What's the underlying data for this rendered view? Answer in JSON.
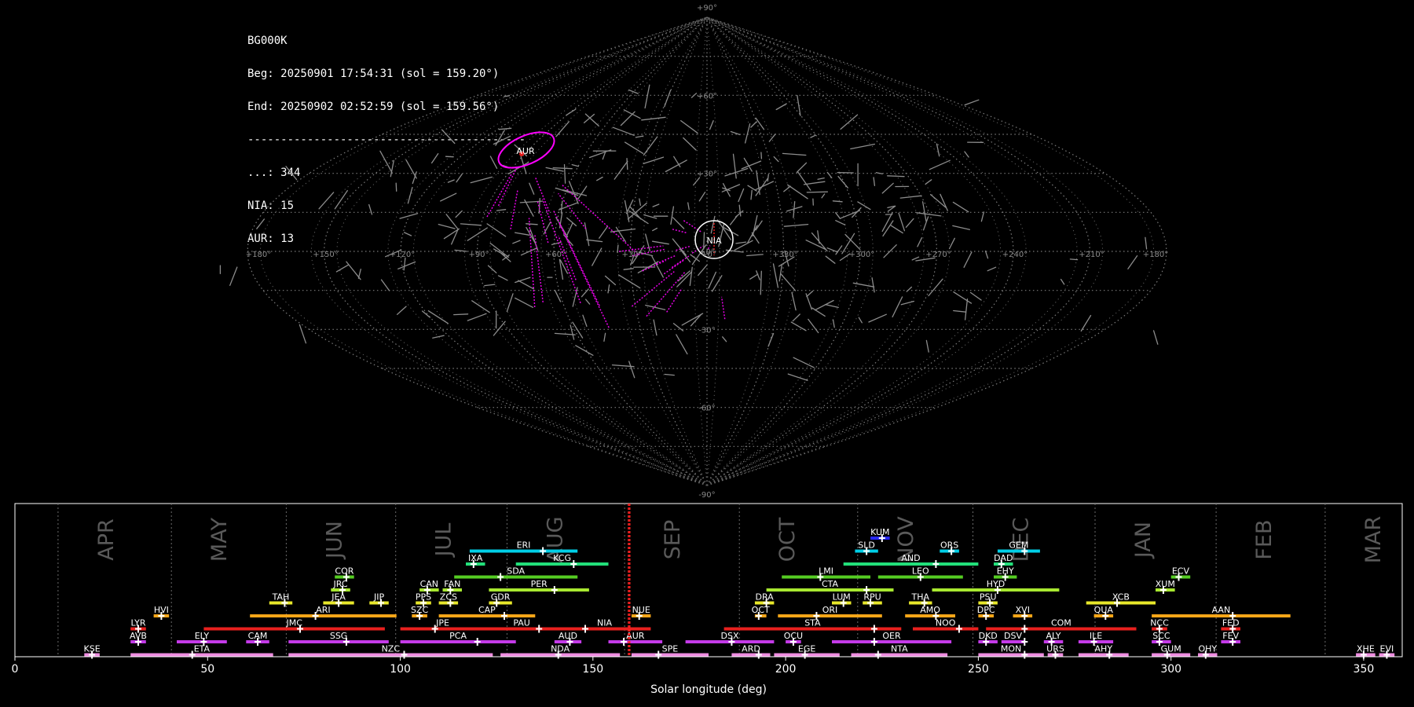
{
  "info": {
    "station": "BG000K",
    "begin": "Beg: 20250901 17:54:31 (sol = 159.20°)",
    "end": "End: 20250902 02:52:59 (sol = 159.56°)",
    "separator": "------------------------------------------",
    "counts": [
      "...: 344",
      "NIA: 15",
      "AUR: 13"
    ]
  },
  "sky_map": {
    "projection": "sinusoidal",
    "lon_labels": [
      "+180°",
      "+150°",
      "+120°",
      "+90°",
      "+60°",
      "+30°",
      "+0°",
      "+330°",
      "+300°",
      "+270°",
      "+240°",
      "+210°",
      "+180°"
    ],
    "lat_labels": [
      "+90°",
      "+60°",
      "+30°",
      "+0°",
      "-30°",
      "-60°",
      "-90°"
    ],
    "radiants": [
      {
        "name": "AUR",
        "color": "#ff00ff"
      },
      {
        "name": "NIA",
        "color": "#ff00ff"
      }
    ],
    "sporadic_color": "#8c8c8c"
  },
  "chart_data": {
    "type": "timeline",
    "xlabel": "Solar longitude (deg)",
    "xlim": [
      0,
      360
    ],
    "x_ticks": [
      0,
      50,
      100,
      150,
      200,
      250,
      300,
      350
    ],
    "current_sol": [
      159.2,
      159.56
    ],
    "months": [
      {
        "name": "APR",
        "sol": 11.2
      },
      {
        "name": "MAY",
        "sol": 40.6
      },
      {
        "name": "JUN",
        "sol": 70.4
      },
      {
        "name": "JUL",
        "sol": 98.8
      },
      {
        "name": "AUG",
        "sol": 127.7
      },
      {
        "name": "SEP",
        "sol": 158.2
      },
      {
        "name": "OCT",
        "sol": 188.0
      },
      {
        "name": "NOV",
        "sol": 218.7
      },
      {
        "name": "DEC",
        "sol": 248.6
      },
      {
        "name": "JAN",
        "sol": 280.3
      },
      {
        "name": "FEB",
        "sol": 311.7
      },
      {
        "name": "MAR",
        "sol": 340.0
      }
    ],
    "showers": [
      {
        "code": "KUM",
        "start": 222,
        "end": 227,
        "peak": 225,
        "row": 9,
        "color": "#2828ff"
      },
      {
        "code": "ERI",
        "start": 118,
        "end": 146,
        "peak": 137,
        "row": 8,
        "color": "#00cfe8"
      },
      {
        "code": "SLD",
        "start": 218,
        "end": 224,
        "peak": 221,
        "row": 8,
        "color": "#00cfe8"
      },
      {
        "code": "ORS",
        "start": 240,
        "end": 245,
        "peak": 243,
        "row": 8,
        "color": "#00cfe8"
      },
      {
        "code": "GEM",
        "start": 255,
        "end": 266,
        "peak": 262,
        "row": 8,
        "color": "#00cfe8"
      },
      {
        "code": "IXA",
        "start": 117,
        "end": 122,
        "peak": 119,
        "row": 7,
        "color": "#22e07a"
      },
      {
        "code": "KCG",
        "start": 130,
        "end": 154,
        "peak": 145,
        "row": 7,
        "color": "#22e07a"
      },
      {
        "code": "AND",
        "start": 215,
        "end": 250,
        "peak": 239,
        "row": 7,
        "color": "#22e07a"
      },
      {
        "code": "DAD",
        "start": 254,
        "end": 259,
        "peak": 256,
        "row": 7,
        "color": "#22e07a"
      },
      {
        "code": "COR",
        "start": 83,
        "end": 88,
        "peak": 86,
        "row": 6,
        "color": "#55cc22"
      },
      {
        "code": "SDA",
        "start": 114,
        "end": 146,
        "peak": 126,
        "row": 6,
        "color": "#55cc22"
      },
      {
        "code": "LMI",
        "start": 199,
        "end": 222,
        "peak": 209,
        "row": 6,
        "color": "#55cc22"
      },
      {
        "code": "LEO",
        "start": 224,
        "end": 246,
        "peak": 235,
        "row": 6,
        "color": "#55cc22"
      },
      {
        "code": "EHY",
        "start": 254,
        "end": 260,
        "peak": 257,
        "row": 6,
        "color": "#55cc22"
      },
      {
        "code": "ECV",
        "start": 300,
        "end": 305,
        "peak": 302,
        "row": 6,
        "color": "#55cc22"
      },
      {
        "code": "JRC",
        "start": 82,
        "end": 87,
        "peak": 85,
        "row": 5,
        "color": "#a8e830"
      },
      {
        "code": "CAN",
        "start": 105,
        "end": 110,
        "peak": 107,
        "row": 5,
        "color": "#a8e830"
      },
      {
        "code": "FAN",
        "start": 111,
        "end": 116,
        "peak": 113,
        "row": 5,
        "color": "#a8e830"
      },
      {
        "code": "PER",
        "start": 123,
        "end": 149,
        "peak": 140,
        "row": 5,
        "color": "#a8e830"
      },
      {
        "code": "CTA",
        "start": 195,
        "end": 228,
        "peak": 221,
        "row": 5,
        "color": "#a8e830"
      },
      {
        "code": "HYD",
        "start": 238,
        "end": 271,
        "peak": 255,
        "row": 5,
        "color": "#a8e830"
      },
      {
        "code": "XUM",
        "start": 296,
        "end": 301,
        "peak": 298,
        "row": 5,
        "color": "#a8e830"
      },
      {
        "code": "TAH",
        "start": 66,
        "end": 72,
        "peak": 70,
        "row": 4,
        "color": "#e8e82a"
      },
      {
        "code": "JEA",
        "start": 80,
        "end": 88,
        "peak": 84,
        "row": 4,
        "color": "#e8e82a"
      },
      {
        "code": "JIP",
        "start": 92,
        "end": 97,
        "peak": 95,
        "row": 4,
        "color": "#e8e82a"
      },
      {
        "code": "PPS",
        "start": 104,
        "end": 108,
        "peak": 106,
        "row": 4,
        "color": "#e8e82a"
      },
      {
        "code": "ZCS",
        "start": 110,
        "end": 115,
        "peak": 113,
        "row": 4,
        "color": "#e8e82a"
      },
      {
        "code": "GDR",
        "start": 123,
        "end": 129,
        "peak": 125,
        "row": 4,
        "color": "#e8e82a"
      },
      {
        "code": "DRA",
        "start": 192,
        "end": 197,
        "peak": 195,
        "row": 4,
        "color": "#e8e82a"
      },
      {
        "code": "LUM",
        "start": 212,
        "end": 217,
        "peak": 215,
        "row": 4,
        "color": "#e8e82a"
      },
      {
        "code": "RPU",
        "start": 220,
        "end": 225,
        "peak": 222,
        "row": 4,
        "color": "#e8e82a"
      },
      {
        "code": "THA",
        "start": 232,
        "end": 238,
        "peak": 236,
        "row": 4,
        "color": "#e8e82a"
      },
      {
        "code": "PSU",
        "start": 250,
        "end": 255,
        "peak": 253,
        "row": 4,
        "color": "#e8e82a"
      },
      {
        "code": "XCB",
        "start": 278,
        "end": 296,
        "peak": 286,
        "row": 4,
        "color": "#e8e82a"
      },
      {
        "code": "HVI",
        "start": 36,
        "end": 40,
        "peak": 38,
        "row": 3,
        "color": "#f5a518"
      },
      {
        "code": "ARI",
        "start": 61,
        "end": 99,
        "peak": 78,
        "row": 3,
        "color": "#f5a518"
      },
      {
        "code": "SZC",
        "start": 103,
        "end": 107,
        "peak": 105,
        "row": 3,
        "color": "#f5a518"
      },
      {
        "code": "CAP",
        "start": 110,
        "end": 135,
        "peak": 127,
        "row": 3,
        "color": "#f5a518"
      },
      {
        "code": "NUE",
        "start": 160,
        "end": 165,
        "peak": 162,
        "row": 3,
        "color": "#f5a518"
      },
      {
        "code": "OCT",
        "start": 192,
        "end": 195,
        "peak": 193,
        "row": 3,
        "color": "#f5a518"
      },
      {
        "code": "ORI",
        "start": 198,
        "end": 225,
        "peak": 208,
        "row": 3,
        "color": "#f5a518"
      },
      {
        "code": "AMO",
        "start": 231,
        "end": 244,
        "peak": 239,
        "row": 3,
        "color": "#f5a518"
      },
      {
        "code": "DPC",
        "start": 250,
        "end": 254,
        "peak": 252,
        "row": 3,
        "color": "#f5a518"
      },
      {
        "code": "XVI",
        "start": 259,
        "end": 264,
        "peak": 262,
        "row": 3,
        "color": "#f5a518"
      },
      {
        "code": "QUA",
        "start": 280,
        "end": 285,
        "peak": 283,
        "row": 3,
        "color": "#f5a518"
      },
      {
        "code": "AAN",
        "start": 295,
        "end": 331,
        "peak": 316,
        "row": 3,
        "color": "#f5a518"
      },
      {
        "code": "LYR",
        "start": 30,
        "end": 34,
        "peak": 32,
        "row": 2,
        "color": "#e8201e"
      },
      {
        "code": "JMC",
        "start": 49,
        "end": 96,
        "peak": 74,
        "row": 2,
        "color": "#e8201e"
      },
      {
        "code": "JPE",
        "start": 100,
        "end": 122,
        "peak": 109,
        "row": 2,
        "color": "#e8201e"
      },
      {
        "code": "PAU",
        "start": 121,
        "end": 142,
        "peak": 136,
        "row": 2,
        "color": "#e8201e"
      },
      {
        "code": "NIA",
        "start": 141,
        "end": 165,
        "peak": 148,
        "row": 2,
        "color": "#e8201e"
      },
      {
        "code": "STA",
        "start": 184,
        "end": 230,
        "peak": 223,
        "row": 2,
        "color": "#e8201e"
      },
      {
        "code": "NOO",
        "start": 233,
        "end": 250,
        "peak": 245,
        "row": 2,
        "color": "#e8201e"
      },
      {
        "code": "COM",
        "start": 252,
        "end": 291,
        "peak": 262,
        "row": 2,
        "color": "#e8201e"
      },
      {
        "code": "NCC",
        "start": 295,
        "end": 299,
        "peak": 297,
        "row": 2,
        "color": "#e8201e"
      },
      {
        "code": "FED",
        "start": 313,
        "end": 318,
        "peak": 316,
        "row": 2,
        "color": "#e8201e"
      },
      {
        "code": "AVB",
        "start": 30,
        "end": 34,
        "peak": 32,
        "row": 1,
        "color": "#c43ae8"
      },
      {
        "code": "ELY",
        "start": 42,
        "end": 55,
        "peak": 49,
        "row": 1,
        "color": "#c43ae8"
      },
      {
        "code": "CAM",
        "start": 60,
        "end": 66,
        "peak": 63,
        "row": 1,
        "color": "#c43ae8"
      },
      {
        "code": "SSG",
        "start": 71,
        "end": 97,
        "peak": 86,
        "row": 1,
        "color": "#c43ae8"
      },
      {
        "code": "PCA",
        "start": 100,
        "end": 130,
        "peak": 120,
        "row": 1,
        "color": "#c43ae8"
      },
      {
        "code": "AUD",
        "start": 140,
        "end": 147,
        "peak": 144,
        "row": 1,
        "color": "#c43ae8"
      },
      {
        "code": "AUR",
        "start": 154,
        "end": 168,
        "peak": 158,
        "row": 1,
        "color": "#c43ae8"
      },
      {
        "code": "DSX",
        "start": 174,
        "end": 197,
        "peak": 186,
        "row": 1,
        "color": "#c43ae8"
      },
      {
        "code": "OCU",
        "start": 200,
        "end": 204,
        "peak": 202,
        "row": 1,
        "color": "#c43ae8"
      },
      {
        "code": "OER",
        "start": 212,
        "end": 243,
        "peak": 223,
        "row": 1,
        "color": "#c43ae8"
      },
      {
        "code": "DKD",
        "start": 250,
        "end": 255,
        "peak": 252,
        "row": 1,
        "color": "#c43ae8"
      },
      {
        "code": "DSV",
        "start": 256,
        "end": 262,
        "peak": 262,
        "row": 1,
        "color": "#c43ae8"
      },
      {
        "code": "ALY",
        "start": 267,
        "end": 272,
        "peak": 269,
        "row": 1,
        "color": "#c43ae8"
      },
      {
        "code": "ILE",
        "start": 276,
        "end": 285,
        "peak": 280,
        "row": 1,
        "color": "#c43ae8"
      },
      {
        "code": "SCC",
        "start": 295,
        "end": 300,
        "peak": 297,
        "row": 1,
        "color": "#c43ae8"
      },
      {
        "code": "FEV",
        "start": 313,
        "end": 318,
        "peak": 316,
        "row": 1,
        "color": "#c43ae8"
      },
      {
        "code": "KSE",
        "start": 18,
        "end": 22,
        "peak": 20,
        "row": 0,
        "color": "#ee8ce0"
      },
      {
        "code": "ETA",
        "start": 30,
        "end": 67,
        "peak": 46,
        "row": 0,
        "color": "#ee8ce0"
      },
      {
        "code": "NZC",
        "start": 71,
        "end": 124,
        "peak": 101,
        "row": 0,
        "color": "#ee8ce0"
      },
      {
        "code": "NDA",
        "start": 126,
        "end": 157,
        "peak": 141,
        "row": 0,
        "color": "#ee8ce0"
      },
      {
        "code": "SPE",
        "start": 160,
        "end": 180,
        "peak": 167,
        "row": 0,
        "color": "#ee8ce0"
      },
      {
        "code": "ARD",
        "start": 186,
        "end": 196,
        "peak": 193,
        "row": 0,
        "color": "#ee8ce0"
      },
      {
        "code": "EGE",
        "start": 197,
        "end": 214,
        "peak": 205,
        "row": 0,
        "color": "#ee8ce0"
      },
      {
        "code": "NTA",
        "start": 217,
        "end": 242,
        "peak": 224,
        "row": 0,
        "color": "#ee8ce0"
      },
      {
        "code": "MON",
        "start": 250,
        "end": 267,
        "peak": 262,
        "row": 0,
        "color": "#ee8ce0"
      },
      {
        "code": "URS",
        "start": 268,
        "end": 272,
        "peak": 270,
        "row": 0,
        "color": "#ee8ce0"
      },
      {
        "code": "AHY",
        "start": 276,
        "end": 289,
        "peak": 284,
        "row": 0,
        "color": "#ee8ce0"
      },
      {
        "code": "GUM",
        "start": 295,
        "end": 305,
        "peak": 299,
        "row": 0,
        "color": "#ee8ce0"
      },
      {
        "code": "OHY",
        "start": 307,
        "end": 312,
        "peak": 309,
        "row": 0,
        "color": "#ee8ce0"
      },
      {
        "code": "XHE",
        "start": 348,
        "end": 353,
        "peak": 350,
        "row": 0,
        "color": "#ee8ce0"
      },
      {
        "code": "EVI",
        "start": 354,
        "end": 358,
        "peak": 356,
        "row": 0,
        "color": "#ee8ce0"
      }
    ]
  }
}
